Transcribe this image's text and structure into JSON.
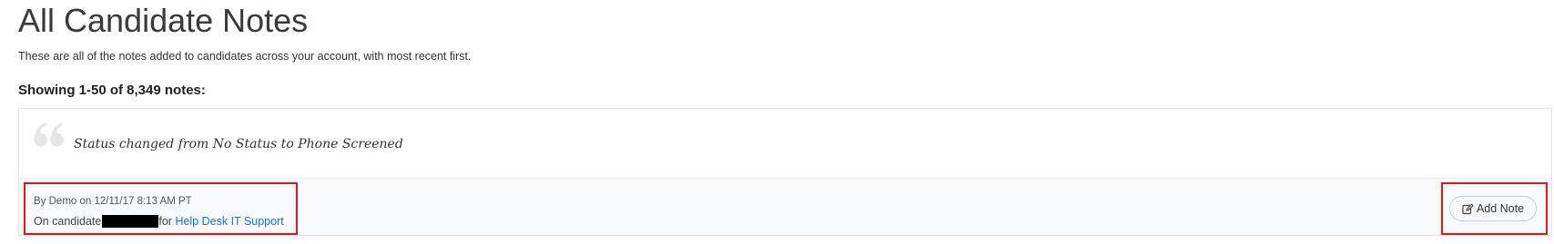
{
  "page": {
    "title": "All Candidate Notes",
    "subtitle": "These are all of the notes added to candidates across your account, with most recent first.",
    "showing": "Showing 1-50 of 8,349 notes:"
  },
  "notes": [
    {
      "quote_icon": "quote-icon",
      "text": "Status changed from No Status to Phone Screened",
      "byline": "By Demo on 12/11/17 8:13 AM PT",
      "candidate_prefix": "On candidate",
      "for_word": "for",
      "job_link": "Help Desk IT Support",
      "add_note_icon": "edit-icon",
      "add_note_label": "Add Note"
    }
  ],
  "colors": {
    "highlight_border": "#e0151f",
    "link": "#1a73c8",
    "footer_bg": "#f8f9fa",
    "redaction": "#000000"
  }
}
